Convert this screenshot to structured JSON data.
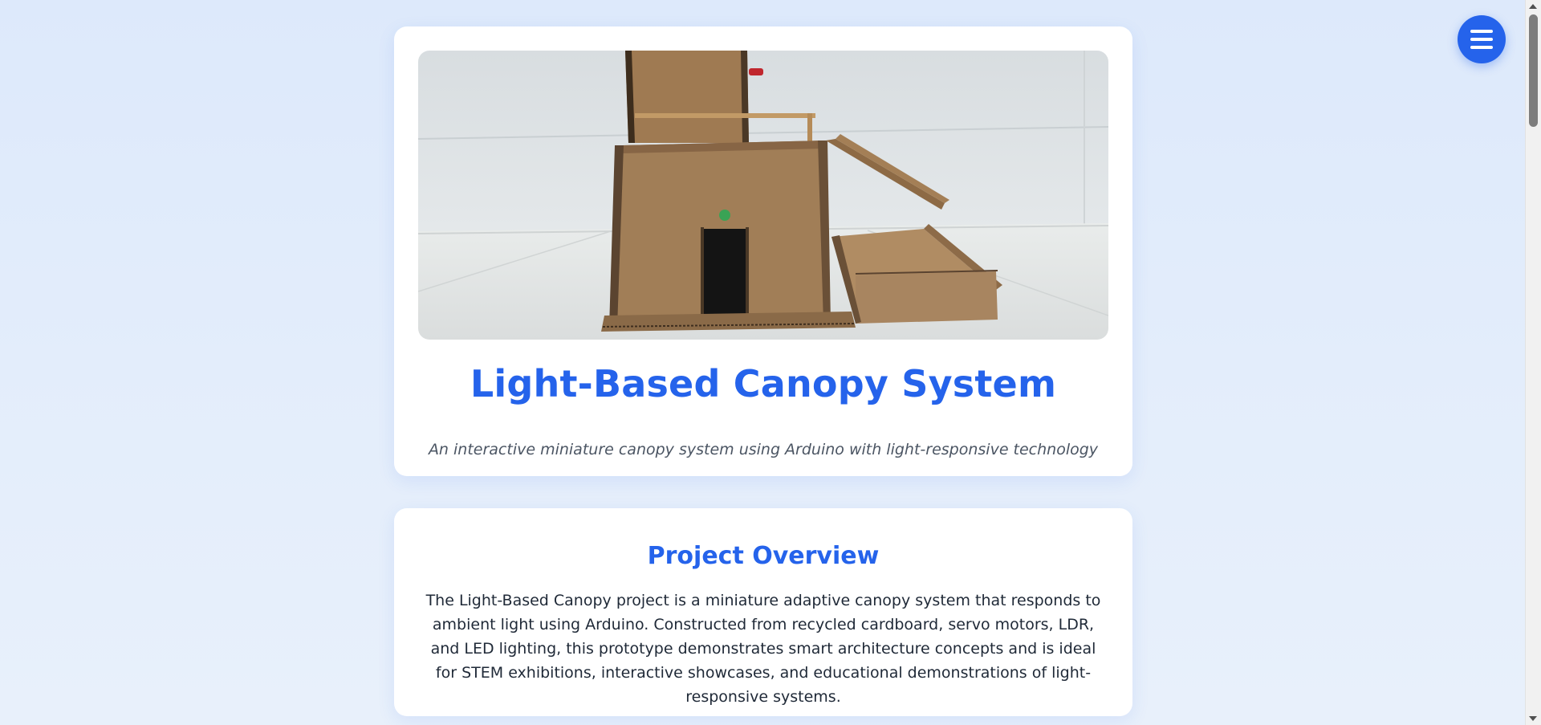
{
  "hero": {
    "image_alt": "Cardboard prototype of the light-based canopy building",
    "title": "Light-Based Canopy System",
    "subtitle": "An interactive miniature canopy system using Arduino with light-responsive technology"
  },
  "overview": {
    "title": "Project Overview",
    "text": "The Light-Based Canopy project is a miniature adaptive canopy system that responds to ambient light using Arduino. Constructed from recycled cardboard, servo motors, LDR, and LED lighting, this prototype demonstrates smart architecture concepts and is ideal for STEM exhibitions, interactive showcases, and educational demonstrations of light-responsive systems."
  },
  "menu": {
    "icon": "hamburger-menu-icon",
    "label": "Menu"
  },
  "colors": {
    "accent": "#2563eb",
    "background": "#dde9fb",
    "card": "#ffffff",
    "text": "#1f2937",
    "muted": "#4b5563"
  }
}
